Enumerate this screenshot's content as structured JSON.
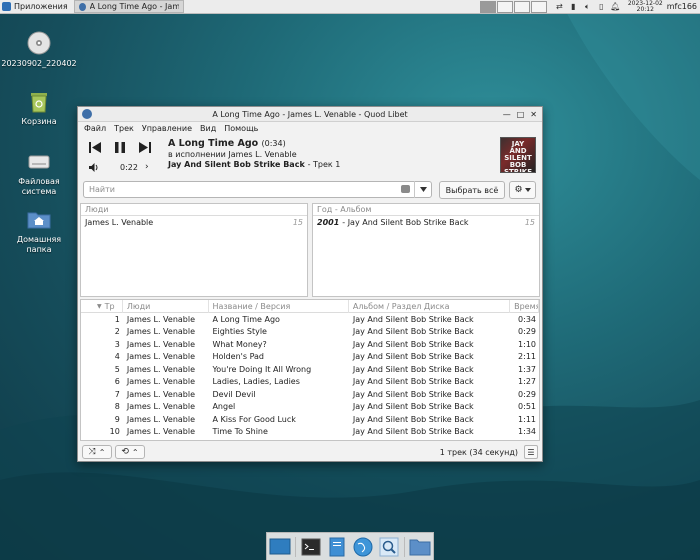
{
  "top_panel": {
    "applications_label": "Приложения",
    "task_label": "A Long Time Ago - Jame...",
    "clock_date": "2023-12-02",
    "clock_time": "20:12",
    "user": "mfc166"
  },
  "desktop": {
    "icons": [
      {
        "label": "20230902_220402",
        "icon": "disc-icon"
      },
      {
        "label": "Корзина",
        "icon": "trash-icon"
      },
      {
        "label": "Файловая система",
        "icon": "drive-icon"
      },
      {
        "label": "Домашняя папка",
        "icon": "home-folder-icon"
      }
    ]
  },
  "window": {
    "title": "A Long Time Ago - James L. Venable - Quod Libet",
    "menu": [
      "Файл",
      "Трек",
      "Управление",
      "Вид",
      "Помощь"
    ],
    "player": {
      "title": "A Long Time Ago",
      "duration": "(0:34)",
      "artist_line": "в исполнении James L. Venable",
      "album": "Jay And Silent Bob Strike Back",
      "track": "- Трек 1",
      "position": "0:22",
      "cover_text": "JAY AND SILENT BOB STRIKE BACK"
    },
    "search": {
      "placeholder": "Найти",
      "value": ""
    },
    "select_all_label": "Выбрать всё",
    "people_pane": {
      "header": "Люди",
      "rows": [
        {
          "name": "James L. Venable",
          "count": "15"
        }
      ]
    },
    "album_pane": {
      "header": "Год - Альбом",
      "rows": [
        {
          "year": "2001",
          "album": "- Jay And Silent Bob Strike Back",
          "count": "15"
        }
      ]
    },
    "songlist": {
      "headers": {
        "track": "Тр",
        "artist": "Люди",
        "title": "Название / Версия",
        "album": "Альбом / Раздел Диска",
        "length": "Время"
      },
      "rows": [
        {
          "n": "1",
          "artist": "James L. Venable",
          "title": "A Long Time Ago",
          "album": "Jay And Silent Bob Strike Back",
          "length": "0:34"
        },
        {
          "n": "2",
          "artist": "James L. Venable",
          "title": "Eighties Style",
          "album": "Jay And Silent Bob Strike Back",
          "length": "0:29"
        },
        {
          "n": "3",
          "artist": "James L. Venable",
          "title": "What Money?",
          "album": "Jay And Silent Bob Strike Back",
          "length": "1:10"
        },
        {
          "n": "4",
          "artist": "James L. Venable",
          "title": "Holden's Pad",
          "album": "Jay And Silent Bob Strike Back",
          "length": "2:11"
        },
        {
          "n": "5",
          "artist": "James L. Venable",
          "title": "You're Doing It All Wrong",
          "album": "Jay And Silent Bob Strike Back",
          "length": "1:37"
        },
        {
          "n": "6",
          "artist": "James L. Venable",
          "title": "Ladies, Ladies, Ladies",
          "album": "Jay And Silent Bob Strike Back",
          "length": "1:27"
        },
        {
          "n": "7",
          "artist": "James L. Venable",
          "title": "Devil Devil",
          "album": "Jay And Silent Bob Strike Back",
          "length": "0:29"
        },
        {
          "n": "8",
          "artist": "James L. Venable",
          "title": "Angel",
          "album": "Jay And Silent Bob Strike Back",
          "length": "0:51"
        },
        {
          "n": "9",
          "artist": "James L. Venable",
          "title": "A Kiss For Good Luck",
          "album": "Jay And Silent Bob Strike Back",
          "length": "1:11"
        },
        {
          "n": "10",
          "artist": "James L. Venable",
          "title": "Time To Shine",
          "album": "Jay And Silent Bob Strike Back",
          "length": "1:34"
        }
      ]
    },
    "status": "1 трек (34 секунд)"
  },
  "colors": {
    "accent": "#3f6fa8",
    "desktop": "#1f6b78"
  }
}
